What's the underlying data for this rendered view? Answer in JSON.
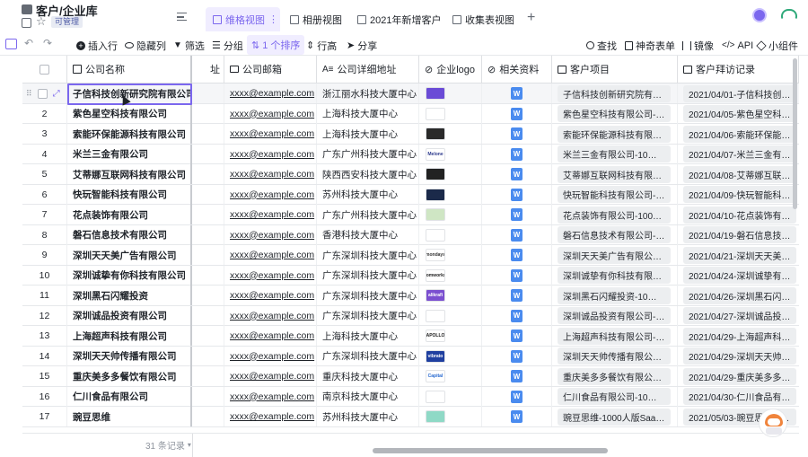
{
  "header": {
    "title": "客户/企业库",
    "badge": "可管理",
    "tabs": [
      {
        "label": "维格视图"
      },
      {
        "label": "相册视图"
      },
      {
        "label": "2021年新增客户"
      },
      {
        "label": "收集表视图"
      }
    ]
  },
  "toolbar": {
    "insert": "插入行",
    "hide": "隐藏列",
    "filter": "筛选",
    "group": "分组",
    "sort": "1 个排序",
    "row_height": "行高",
    "share": "分享",
    "find": "查找",
    "form": "神奇表单",
    "mirror": "镜像",
    "api": "API",
    "widget": "小组件"
  },
  "columns": {
    "name": "公司名称",
    "addr_partial": "址",
    "email": "公司邮箱",
    "address": "公司详细地址",
    "logo": "企业logo",
    "docs": "相关资料",
    "project": "客户项目",
    "visit": "客户拜访记录"
  },
  "rows": [
    {
      "idx": "1",
      "name": "子信科技创新研究院有限公司",
      "email": "xxxx@example.com",
      "address": "浙江丽水科技大厦中心",
      "project": "子信科技创新研究院有限公...",
      "visit": "2021/04/01-子信科技创新...",
      "logo_color": "#6a4bd6",
      "logo_text": "",
      "logo_fg": "#fff"
    },
    {
      "idx": "2",
      "name": "紫色星空科技有限公司",
      "email": "xxxx@example.com",
      "address": "上海科技大厦中心",
      "project": "紫色星空科技有限公司-100...",
      "visit": "2021/04/05-紫色星空科技...",
      "logo_color": "#ffffff",
      "logo_text": "",
      "logo_fg": "#5a4fd0"
    },
    {
      "idx": "3",
      "name": "索能环保能源科技有限公司",
      "email": "xxxx@example.com",
      "address": "上海科技大厦中心",
      "project": "索能环保能源科技有限公司...",
      "visit": "2021/04/06-索能环保能源...",
      "logo_color": "#2a2a2a",
      "logo_text": "",
      "logo_fg": "#e4572e"
    },
    {
      "idx": "4",
      "name": "米兰三金有限公司",
      "email": "xxxx@example.com",
      "address": "广东广州科技大厦中心",
      "project": "米兰三金有限公司-10人版S...",
      "visit": "2021/04/07-米兰三金有限...",
      "logo_color": "#ffffff",
      "logo_text": "Melone",
      "logo_fg": "#2d3a8c"
    },
    {
      "idx": "5",
      "name": "艾蒂娜互联网科技有限公司",
      "email": "xxxx@example.com",
      "address": "陕西西安科技大厦中心",
      "project": "艾蒂娜互联网科技有限公司...",
      "visit": "2021/04/08-艾蒂娜互联网...",
      "logo_color": "#222222",
      "logo_text": "",
      "logo_fg": "#fff"
    },
    {
      "idx": "6",
      "name": "快玩智能科技有限公司",
      "email": "xxxx@example.com",
      "address": "苏州科技大厦中心",
      "project": "快玩智能科技有限公司-10...",
      "visit": "2021/04/09-快玩智能科技...",
      "logo_color": "#1b2a4a",
      "logo_text": "",
      "logo_fg": "#fff"
    },
    {
      "idx": "7",
      "name": "花点装饰有限公司",
      "email": "xxxx@example.com",
      "address": "广东广州科技大厦中心",
      "project": "花点装饰有限公司-100人版...",
      "visit": "2021/04/10-花点装饰有限...",
      "logo_color": "#cfe6c4",
      "logo_text": "",
      "logo_fg": "#2b6b2b"
    },
    {
      "idx": "8",
      "name": "磐石信息技术有限公司",
      "email": "xxxx@example.com",
      "address": "香港科技大厦中心",
      "project": "磐石信息技术有限公司-100...",
      "visit": "2021/04/19-磐石信息技术...",
      "logo_color": "#ffffff",
      "logo_text": "",
      "logo_fg": "#3a7bd5"
    },
    {
      "idx": "9",
      "name": "深圳天天美广告有限公司",
      "email": "xxxx@example.com",
      "address": "广东深圳科技大厦中心",
      "project": "深圳天天美广告有限公司-3...",
      "visit": "2021/04/21-深圳天天美广...",
      "logo_color": "#ffffff",
      "logo_text": "mondays",
      "logo_fg": "#333"
    },
    {
      "idx": "10",
      "name": "深圳诚挚有你科技有限公司",
      "email": "xxxx@example.com",
      "address": "广东深圳科技大厦中心",
      "project": "深圳诚挚有你科技有限公司...",
      "visit": "2021/04/24-深圳诚挚有你...",
      "logo_color": "#ffffff",
      "logo_text": "jomworks",
      "logo_fg": "#222"
    },
    {
      "idx": "11",
      "name": "深圳黑石闪耀投资",
      "email": "xxxx@example.com",
      "address": "广东深圳科技大厦中心",
      "project": "深圳黑石闪耀投资-10人版S...",
      "visit": "2021/04/26-深圳黑石闪耀...",
      "logo_color": "#7b4fd0",
      "logo_text": "alikrafi",
      "logo_fg": "#fff"
    },
    {
      "idx": "12",
      "name": "深圳诚品投资有限公司",
      "email": "xxxx@example.com",
      "address": "广东深圳科技大厦中心",
      "project": "深圳诚品投资有限公司-100...",
      "visit": "2021/04/27-深圳诚品投资...",
      "logo_color": "#ffffff",
      "logo_text": "",
      "logo_fg": "#2a5fa8"
    },
    {
      "idx": "13",
      "name": "上海超声科技有限公司",
      "email": "xxxx@example.com",
      "address": "上海科技大厦中心",
      "project": "上海超声科技有限公司-30...",
      "visit": "2021/04/29-上海超声科技...",
      "logo_color": "#ffffff",
      "logo_text": "APOLLO",
      "logo_fg": "#1a1a1a"
    },
    {
      "idx": "14",
      "name": "深圳天天帅传播有限公司",
      "email": "xxxx@example.com",
      "address": "广东深圳科技大厦中心",
      "project": "深圳天天帅传播有限公司-5...",
      "visit": "2021/04/29-深圳天天帅传...",
      "logo_color": "#1f3fa0",
      "logo_text": "vibrato",
      "logo_fg": "#fff"
    },
    {
      "idx": "15",
      "name": "重庆美多多餐饮有限公司",
      "email": "xxxx@example.com",
      "address": "重庆科技大厦中心",
      "project": "重庆美多多餐饮有限公司-1...",
      "visit": "2021/04/29-重庆美多多餐...",
      "logo_color": "#ffffff",
      "logo_text": "Capital",
      "logo_fg": "#2a6bd0"
    },
    {
      "idx": "16",
      "name": "仁川食品有限公司",
      "email": "xxxx@example.com",
      "address": "南京科技大厦中心",
      "project": "仁川食品有限公司-10人版S...",
      "visit": "2021/04/30-仁川食品有限...",
      "logo_color": "#ffffff",
      "logo_text": "",
      "logo_fg": "#2a3f8f"
    },
    {
      "idx": "17",
      "name": "豌豆思维",
      "email": "xxxx@example.com",
      "address": "苏州科技大厦中心",
      "project": "豌豆思维-1000人版SaaS系...",
      "visit": "2021/05/03-豌豆思维-10...",
      "logo_color": "#8fd9c6",
      "logo_text": "",
      "logo_fg": "#fff"
    }
  ],
  "doc_icon_letter": "W",
  "footer": {
    "records": "31 条记录"
  },
  "colors": {
    "accent": "#7b67ee",
    "active_tab_bg": "#f0edff",
    "sort_color": "#7b67ee"
  }
}
